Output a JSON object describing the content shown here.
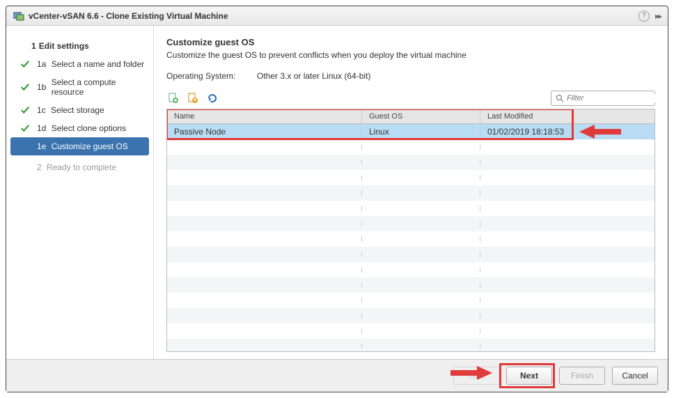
{
  "title": "vCenter-vSAN 6.6 - Clone Existing Virtual Machine",
  "sidebar": {
    "root": {
      "num": "1",
      "label": "Edit settings"
    },
    "items": [
      {
        "num": "1a",
        "label": "Select a name and folder",
        "done": true
      },
      {
        "num": "1b",
        "label": "Select a compute resource",
        "done": true
      },
      {
        "num": "1c",
        "label": "Select storage",
        "done": true
      },
      {
        "num": "1d",
        "label": "Select clone options",
        "done": true
      },
      {
        "num": "1e",
        "label": "Customize guest OS",
        "current": true
      }
    ],
    "after": {
      "num": "2",
      "label": "Ready to complete"
    }
  },
  "main": {
    "heading": "Customize guest OS",
    "subtitle": "Customize the guest OS to prevent conflicts when you deploy the virtual machine",
    "os_label": "Operating System:",
    "os_value": "Other 3.x or later Linux (64-bit)",
    "filter_placeholder": "Filter",
    "columns": {
      "name": "Name",
      "guest": "Guest OS",
      "modified": "Last Modified"
    },
    "rows": [
      {
        "name": "Passive Node",
        "guest": "Linux",
        "modified": "01/02/2019 18:18:53",
        "selected": true
      }
    ]
  },
  "buttons": {
    "back": "Back",
    "next": "Next",
    "finish": "Finish",
    "cancel": "Cancel"
  }
}
